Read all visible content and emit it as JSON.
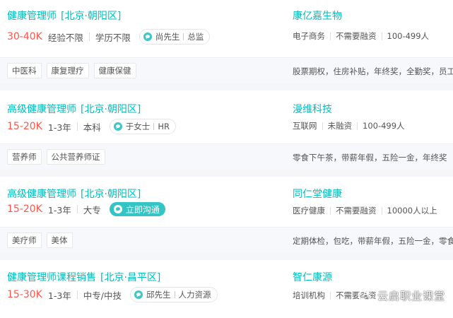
{
  "jobs": [
    {
      "title": "健康管理师",
      "location": "[北京·朝阳区]",
      "salary": "30-40K",
      "experience": "经验不限",
      "education": "学历不限",
      "contact_name": "尚先生",
      "contact_role": "总监",
      "chat_label": "",
      "company": "康亿嘉生物",
      "industry": "电子商务",
      "funding": "不需要融资",
      "size": "100-499人",
      "tags": [
        "中医科",
        "康复理疗",
        "健康保健"
      ],
      "benefits": "股票期权，住房补贴，年终奖，全勤奖，员工"
    },
    {
      "title": "高级健康管理师",
      "location": "[北京·朝阳区]",
      "salary": "15-20K",
      "experience": "1-3年",
      "education": "本科",
      "contact_name": "于女士",
      "contact_role": "HR",
      "chat_label": "",
      "company": "漫维科技",
      "industry": "互联网",
      "funding": "未融资",
      "size": "100-499人",
      "tags": [
        "营养师",
        "公共营养师证"
      ],
      "benefits": "零食下午茶，带薪年假，五险一金，年终奖"
    },
    {
      "title": "高级健康管理师",
      "location": "[北京·朝阳区]",
      "salary": "15-20K",
      "experience": "1-3年",
      "education": "大专",
      "contact_name": "",
      "contact_role": "",
      "chat_label": "立即沟通",
      "company": "同仁堂健康",
      "industry": "医疗健康",
      "funding": "不需要融资",
      "size": "10000人以上",
      "tags": [
        "美疗师",
        "美体"
      ],
      "benefits": "定期体检，包吃，带薪年假，五险一金，零食"
    },
    {
      "title": "健康管理师课程销售",
      "location": "[北京·昌平区]",
      "salary": "15-30K",
      "experience": "1-3年",
      "education": "中专/中技",
      "contact_name": "邱先生",
      "contact_role": "人力资源",
      "chat_label": "",
      "company": "智仁康源",
      "industry": "培训机构",
      "funding": "不需要融资",
      "size": "",
      "tags": [],
      "benefits": ""
    }
  ],
  "watermark": {
    "text": "云启职业课堂",
    "icon": "wechat-icon"
  },
  "colors": {
    "accent": "#00bebd",
    "salary": "#fe574a",
    "background": "#f6f6f8"
  }
}
